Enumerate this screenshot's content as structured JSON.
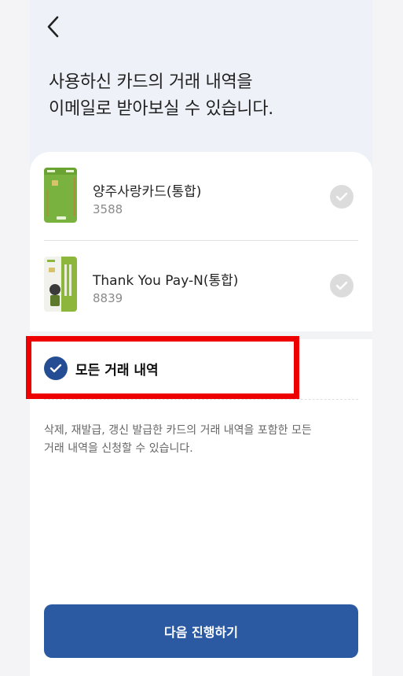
{
  "heading": {
    "line1": "사용하신 카드의 거래 내역을",
    "line2": "이메일로 받아보실 수 있습니다."
  },
  "cards": [
    {
      "name": "양주사랑카드(통합)",
      "number": "3588"
    },
    {
      "name": "Thank You Pay-N(통합)",
      "number": "8839"
    }
  ],
  "all_history": {
    "label": "모든 거래 내역",
    "checked": true
  },
  "description": {
    "line1": "삭제, 재발급, 갱신 발급한 카드의 거래 내역을 포함한 모든",
    "line2": "거래 내역을 신청할 수 있습니다."
  },
  "next_button": {
    "label": "다음 진행하기"
  },
  "colors": {
    "accent": "#2b5aa3",
    "highlight": "#ee0000",
    "header_bg": "#eef2f8"
  },
  "icons": {
    "back": "chevron-left-icon",
    "check": "check-icon"
  }
}
